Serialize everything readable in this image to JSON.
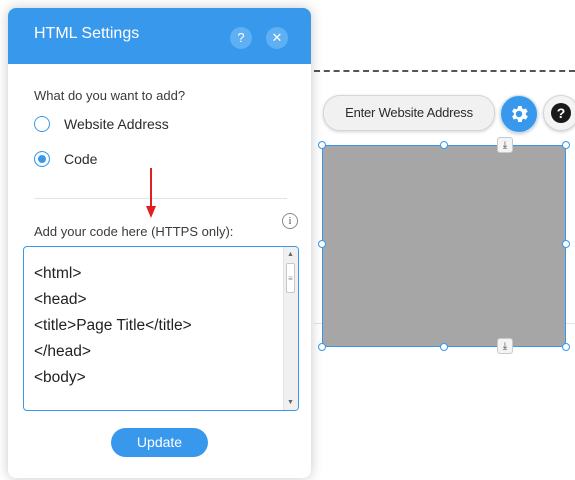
{
  "panel": {
    "title": "HTML Settings",
    "help_label": "?",
    "close_label": "✕",
    "question": "What do you want to add?",
    "options": [
      {
        "label": "Website Address",
        "selected": false
      },
      {
        "label": "Code",
        "selected": true
      }
    ],
    "code_label": "Add your code here (HTTPS only):",
    "info_label": "i",
    "code_value": "<html>\n<head>\n<title>Page Title</title>\n</head>\n<body>",
    "update_label": "Update"
  },
  "canvas": {
    "address_button": "Enter Website Address",
    "help_label": "?"
  },
  "colors": {
    "accent": "#3899ec",
    "placeholder_fill": "#a6a6a6",
    "arrow": "#e02020"
  },
  "icons": [
    "help-icon",
    "close-icon",
    "info-icon",
    "gear-icon",
    "anchor-icon",
    "scroll-up-icon",
    "scroll-down-icon",
    "arrow-down-icon"
  ]
}
